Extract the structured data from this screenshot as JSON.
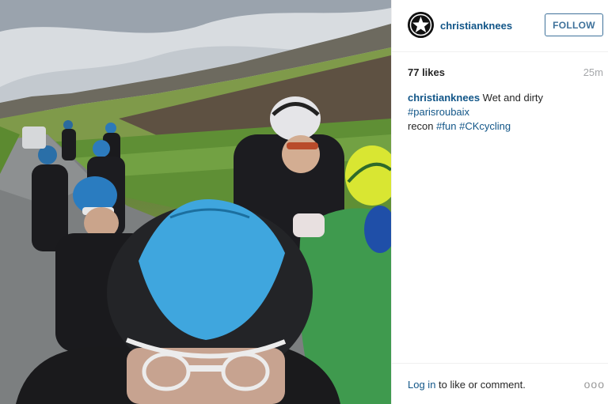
{
  "post": {
    "username": "christianknees",
    "follow_label": "FOLLOW",
    "likes": "77 likes",
    "time_ago": "25m",
    "caption": {
      "username": "christianknees",
      "text_before": "Wet and dirty",
      "hashtags": [
        "#parisroubaix",
        "#fun",
        "#CKcycling"
      ],
      "word_between": "recon"
    },
    "footer": {
      "login_link": "Log in",
      "login_rest": "to like or comment.",
      "more_label": "ooo"
    }
  },
  "icons": {
    "avatar": "star-logo-icon",
    "more": "more-options-icon"
  },
  "colors": {
    "link": "#125688",
    "follow_border": "#3f729b",
    "muted": "#a5a7aa"
  }
}
